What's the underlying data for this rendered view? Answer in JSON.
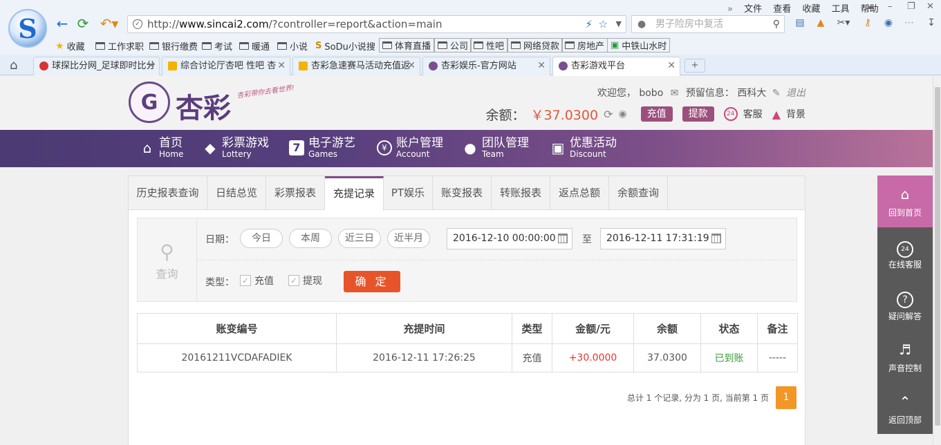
{
  "browser": {
    "url_prefix": "http://",
    "url_domain": "www.sincai2.com",
    "url_path": "/?controller=report&action=main",
    "search_placeholder": "男子险房中复活",
    "menu": [
      "文件",
      "查看",
      "收藏",
      "工具",
      "帮助"
    ],
    "bookmarks": [
      "收藏",
      "工作求职",
      "银行缴费",
      "考试",
      "暖通",
      "小说",
      "SoDu小说搜",
      "体育直播",
      "公司",
      "性吧",
      "网络贷款",
      "房地产",
      "中铁山水时"
    ],
    "tabs": [
      {
        "title": "球探比分网_足球即时比分",
        "active": false
      },
      {
        "title": "综合讨论厅杏吧 性吧 杏",
        "active": false
      },
      {
        "title": "杏彩急速赛马活动充值返",
        "active": false
      },
      {
        "title": "杏彩娱乐-官方网站",
        "active": false
      },
      {
        "title": "杏彩游戏平台",
        "active": true
      }
    ]
  },
  "site": {
    "brand": "杏彩",
    "slogan": "杏彩带你去看世界!",
    "welcome": "欢迎您，",
    "username": "bobo",
    "reserve_label": "预留信息：",
    "reserve_value": "西科大",
    "logout": "退出",
    "balance_label": "余额：",
    "balance": "￥37.0300",
    "deposit": "充值",
    "withdraw": "提款",
    "service": "客服",
    "background": "背景"
  },
  "nav": [
    {
      "cn": "首页",
      "en": "Home",
      "icon": "home-icon"
    },
    {
      "cn": "彩票游戏",
      "en": "Lottery",
      "icon": "lottery-icon"
    },
    {
      "cn": "电子游艺",
      "en": "Games",
      "icon": "seven-icon"
    },
    {
      "cn": "账户管理",
      "en": "Account",
      "icon": "yen-icon"
    },
    {
      "cn": "团队管理",
      "en": "Team",
      "icon": "team-icon"
    },
    {
      "cn": "优惠活动",
      "en": "Discount",
      "icon": "gift-icon"
    }
  ],
  "subtabs": [
    "历史报表查询",
    "日结总览",
    "彩票报表",
    "充提记录",
    "PT娱乐",
    "账变报表",
    "转账报表",
    "返点总额",
    "余额查询"
  ],
  "active_subtab": "充提记录",
  "query": {
    "icon_label": "查询",
    "date_label": "日期：",
    "quick": [
      "今日",
      "本周",
      "近三日",
      "近半月"
    ],
    "start": "2016-12-10 00:00:00",
    "to": "至",
    "end": "2016-12-11 17:31:19",
    "type_label": "类型：",
    "types": [
      "充值",
      "提现"
    ],
    "confirm": "确 定"
  },
  "table": {
    "headers": [
      "账变编号",
      "充提时间",
      "类型",
      "金额/元",
      "余额",
      "状态",
      "备注"
    ],
    "rows": [
      [
        "20161211VCDAFADIEK",
        "2016-12-11 17:26:25",
        "充值",
        "+30.0000",
        "37.0300",
        "已到账",
        "-----"
      ]
    ]
  },
  "pager": {
    "summary": "总计 1 个记录, 分为 1 页, 当前第 1 页",
    "current": "1"
  },
  "sidebar": [
    "回到首页",
    "在线客服",
    "疑问解答",
    "声音控制",
    "返回顶部"
  ]
}
